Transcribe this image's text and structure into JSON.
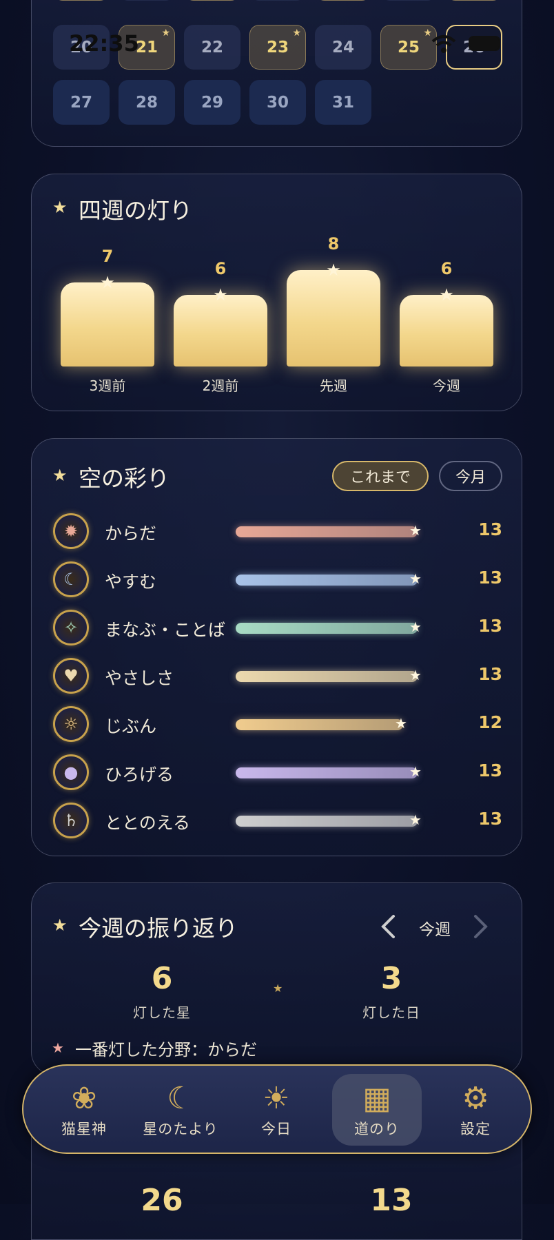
{
  "status": {
    "time": "22:35"
  },
  "calendar": {
    "row_partial": [
      "",
      "",
      "",
      "",
      "",
      "",
      ""
    ],
    "row2": [
      {
        "n": "20",
        "state": "norm"
      },
      {
        "n": "21",
        "state": "lit"
      },
      {
        "n": "22",
        "state": "norm"
      },
      {
        "n": "23",
        "state": "lit"
      },
      {
        "n": "24",
        "state": "norm"
      },
      {
        "n": "25",
        "state": "lit"
      },
      {
        "n": "26",
        "state": "today"
      }
    ],
    "row3": [
      "27",
      "28",
      "29",
      "30",
      "31"
    ]
  },
  "weeks": {
    "title": "四週の灯り",
    "bars": [
      {
        "label": "3週前",
        "value": 7
      },
      {
        "label": "2週前",
        "value": 6
      },
      {
        "label": "先週",
        "value": 8
      },
      {
        "label": "今週",
        "value": 6
      }
    ]
  },
  "colors": {
    "title": "空の彩り",
    "filter_all": "これまで",
    "filter_month": "今月",
    "rows": [
      {
        "label": "からだ",
        "count": "13",
        "fraction": 1.0,
        "color": "#e8a896",
        "icon": "flame-medal-icon",
        "glyph": "✹"
      },
      {
        "label": "やすむ",
        "count": "13",
        "fraction": 1.0,
        "color": "#a9c3e8",
        "icon": "moon-medal-icon",
        "glyph": "☾"
      },
      {
        "label": "まなぶ・ことば",
        "count": "13",
        "fraction": 1.0,
        "color": "#a8dcc4",
        "icon": "book-medal-icon",
        "glyph": "✧"
      },
      {
        "label": "やさしさ",
        "count": "13",
        "fraction": 1.0,
        "color": "#ecd9ae",
        "icon": "heart-medal-icon",
        "glyph": "♥"
      },
      {
        "label": "じぶん",
        "count": "12",
        "fraction": 0.92,
        "color": "#f0cc8e",
        "icon": "sun-medal-icon",
        "glyph": "☼"
      },
      {
        "label": "ひろげる",
        "count": "13",
        "fraction": 1.0,
        "color": "#c9b8ec",
        "icon": "planet-medal-icon",
        "glyph": "●"
      },
      {
        "label": "ととのえる",
        "count": "13",
        "fraction": 1.0,
        "color": "#cfcfcf",
        "icon": "saturn-medal-icon",
        "glyph": "♄"
      }
    ]
  },
  "weekly": {
    "title": "今週の振り返り",
    "period": "今週",
    "stars_value": "6",
    "stars_label": "灯した星",
    "days_value": "3",
    "days_label": "灯した日",
    "top_category": "一番灯した分野：からだ"
  },
  "bottom_card": {
    "left_value": "26",
    "right_value": "13"
  },
  "nav": [
    {
      "label": "猫星神",
      "icon": "cat-icon",
      "glyph": "❀",
      "active": false
    },
    {
      "label": "星のたより",
      "icon": "crescent-moon-icon",
      "glyph": "☾",
      "active": false
    },
    {
      "label": "今日",
      "icon": "sun-icon",
      "glyph": "☀",
      "active": false
    },
    {
      "label": "道のり",
      "icon": "calendar-icon",
      "glyph": "▦",
      "active": true
    },
    {
      "label": "設定",
      "icon": "gear-icon",
      "glyph": "⚙",
      "active": false
    }
  ]
}
